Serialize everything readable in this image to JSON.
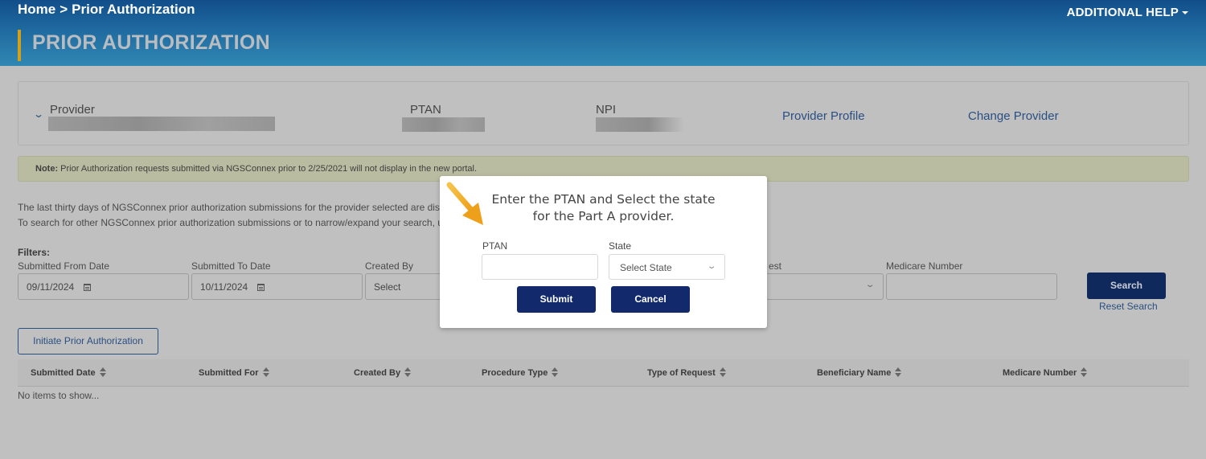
{
  "header": {
    "breadcrumb": [
      {
        "label": "Home"
      },
      {
        "label": "Prior Authorization"
      }
    ],
    "breadcrumb_separator": ">",
    "additional_help": "ADDITIONAL HELP",
    "page_title": "PRIOR AUTHORIZATION",
    "accent_color": "#d4a017"
  },
  "provider": {
    "provider_label": "Provider",
    "ptan_label": "PTAN",
    "npi_label": "NPI",
    "provider_profile_link": "Provider Profile",
    "change_provider_link": "Change Provider"
  },
  "note": {
    "bold": "Note:",
    "text": " Prior Authorization requests submitted via NGSConnex prior to 2/25/2021 will not display in the new portal."
  },
  "info": {
    "line1": "The last thirty days of NGSConnex prior authorization submissions for the provider selected are disp",
    "line2": "To search for other NGSConnex prior authorization submissions or to narrow/expand your search, u"
  },
  "filters": {
    "title": "Filters:",
    "submitted_from": {
      "label": "Submitted From Date",
      "value": "09/11/2024"
    },
    "submitted_to": {
      "label": "Submitted To Date",
      "value": "10/11/2024"
    },
    "created_by": {
      "label": "Created By",
      "value": "Select"
    },
    "type_of_request": {
      "label_partial": "est",
      "value": ""
    },
    "medicare_number": {
      "label": "Medicare Number",
      "value": ""
    },
    "search_button": "Search",
    "reset_link": "Reset Search"
  },
  "initiate_button": "Initiate Prior Authorization",
  "table": {
    "columns": [
      "Submitted Date",
      "Submitted For",
      "Created By",
      "Procedure Type",
      "Type of Request",
      "Beneficiary Name",
      "Medicare Number"
    ],
    "empty_message": "No items to show..."
  },
  "modal": {
    "title_line1": "Enter the PTAN and Select the state",
    "title_line2": "for the Part A provider.",
    "ptan_label": "PTAN",
    "ptan_value": "",
    "state_label": "State",
    "state_placeholder": "Select State",
    "submit_button": "Submit",
    "cancel_button": "Cancel",
    "button_color": "#12296b",
    "annotation_arrow_color": "#f0a81c"
  }
}
